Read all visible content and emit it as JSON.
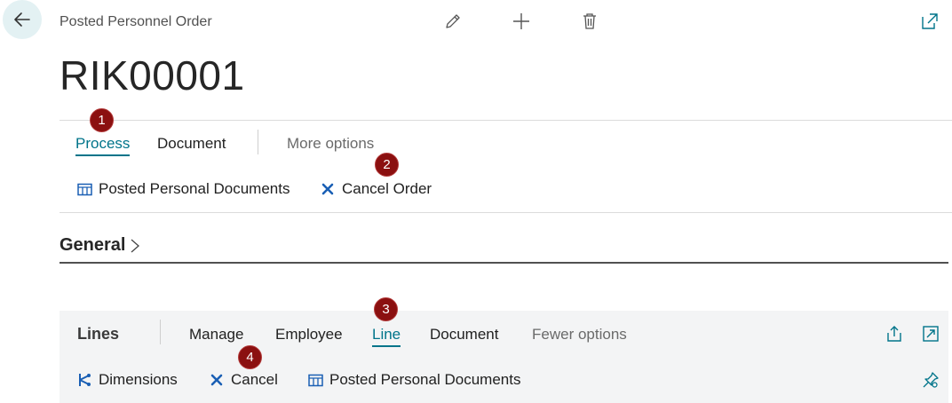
{
  "header": {
    "caption": "Posted Personnel Order",
    "record_title": "RIK00001"
  },
  "action_bar": {
    "tabs": [
      {
        "label": "Process",
        "active": true
      },
      {
        "label": "Document",
        "active": false
      },
      {
        "label": "More options",
        "active": false
      }
    ],
    "actions": [
      {
        "label": "Posted Personal Documents",
        "icon": "table-icon"
      },
      {
        "label": "Cancel Order",
        "icon": "x-icon"
      }
    ]
  },
  "general_section": {
    "title": "General"
  },
  "lines": {
    "title": "Lines",
    "tabs": [
      {
        "label": "Manage",
        "active": false
      },
      {
        "label": "Employee",
        "active": false
      },
      {
        "label": "Line",
        "active": true
      },
      {
        "label": "Document",
        "active": false
      },
      {
        "label": "Fewer options",
        "active": false
      }
    ],
    "actions": [
      {
        "label": "Dimensions",
        "icon": "dimensions-icon"
      },
      {
        "label": "Cancel",
        "icon": "x-icon"
      },
      {
        "label": "Posted Personal Documents",
        "icon": "table-icon"
      }
    ]
  },
  "badges": [
    "1",
    "2",
    "3",
    "4"
  ],
  "colors": {
    "accent": "#00748a",
    "badge": "#8b1010",
    "panel_bg": "#f3f4f5"
  }
}
